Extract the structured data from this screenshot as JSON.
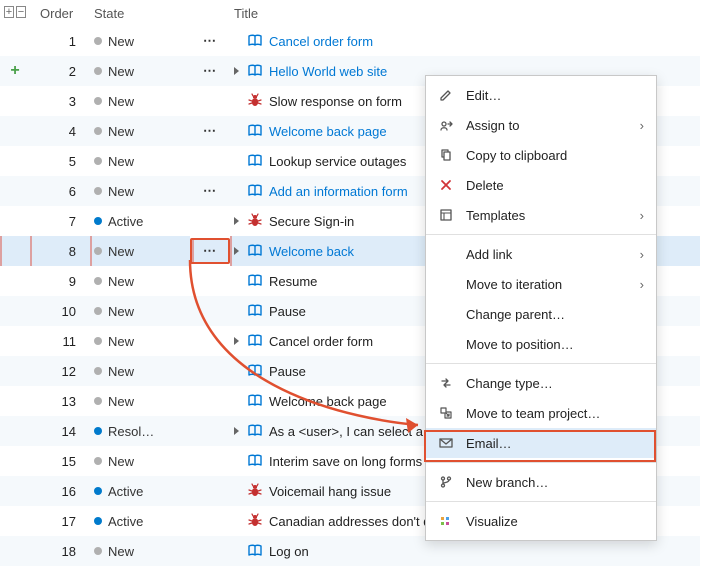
{
  "columns": {
    "order": "Order",
    "state": "State",
    "title": "Title"
  },
  "rows": [
    {
      "order": "1",
      "state": "New",
      "stateColor": "gray",
      "showActions": true,
      "hasChevron": false,
      "iconKind": "book",
      "title": "Cancel order form",
      "link": true,
      "alt": false,
      "gutter": ""
    },
    {
      "order": "2",
      "state": "New",
      "stateColor": "gray",
      "showActions": true,
      "hasChevron": true,
      "iconKind": "book",
      "title": "Hello World web site",
      "link": true,
      "alt": true,
      "gutter": "plus"
    },
    {
      "order": "3",
      "state": "New",
      "stateColor": "gray",
      "showActions": false,
      "hasChevron": false,
      "iconKind": "bug",
      "title": "Slow response on form",
      "link": false,
      "alt": false,
      "gutter": ""
    },
    {
      "order": "4",
      "state": "New",
      "stateColor": "gray",
      "showActions": true,
      "hasChevron": false,
      "iconKind": "book",
      "title": "Welcome back page",
      "link": true,
      "alt": true,
      "gutter": ""
    },
    {
      "order": "5",
      "state": "New",
      "stateColor": "gray",
      "showActions": false,
      "hasChevron": false,
      "iconKind": "book",
      "title": "Lookup service outages",
      "link": false,
      "alt": false,
      "gutter": ""
    },
    {
      "order": "6",
      "state": "New",
      "stateColor": "gray",
      "showActions": true,
      "hasChevron": false,
      "iconKind": "book",
      "title": "Add an information form",
      "link": true,
      "alt": true,
      "gutter": ""
    },
    {
      "order": "7",
      "state": "Active",
      "stateColor": "blue",
      "showActions": false,
      "hasChevron": true,
      "iconKind": "bug",
      "title": "Secure Sign-in",
      "link": false,
      "alt": false,
      "gutter": ""
    },
    {
      "order": "8",
      "state": "New",
      "stateColor": "gray",
      "showActions": true,
      "hasChevron": true,
      "iconKind": "book",
      "title": "Welcome back",
      "link": true,
      "alt": true,
      "gutter": "",
      "selected": true,
      "boxActions": true
    },
    {
      "order": "9",
      "state": "New",
      "stateColor": "gray",
      "showActions": false,
      "hasChevron": false,
      "iconKind": "book",
      "title": "Resume",
      "link": false,
      "alt": false,
      "gutter": ""
    },
    {
      "order": "10",
      "state": "New",
      "stateColor": "gray",
      "showActions": false,
      "hasChevron": false,
      "iconKind": "book",
      "title": "Pause",
      "link": false,
      "alt": true,
      "gutter": ""
    },
    {
      "order": "11",
      "state": "New",
      "stateColor": "gray",
      "showActions": false,
      "hasChevron": true,
      "iconKind": "book",
      "title": "Cancel order form",
      "link": false,
      "alt": false,
      "gutter": ""
    },
    {
      "order": "12",
      "state": "New",
      "stateColor": "gray",
      "showActions": false,
      "hasChevron": false,
      "iconKind": "book",
      "title": "Pause",
      "link": false,
      "alt": true,
      "gutter": ""
    },
    {
      "order": "13",
      "state": "New",
      "stateColor": "gray",
      "showActions": false,
      "hasChevron": false,
      "iconKind": "book",
      "title": "Welcome back page",
      "link": false,
      "alt": false,
      "gutter": ""
    },
    {
      "order": "14",
      "state": "Resol…",
      "stateColor": "blue",
      "showActions": false,
      "hasChevron": true,
      "iconKind": "book",
      "title": "As a <user>, I can select a numbe",
      "link": false,
      "alt": true,
      "gutter": ""
    },
    {
      "order": "15",
      "state": "New",
      "stateColor": "gray",
      "showActions": false,
      "hasChevron": false,
      "iconKind": "book",
      "title": "Interim save on long forms",
      "link": false,
      "alt": false,
      "gutter": ""
    },
    {
      "order": "16",
      "state": "Active",
      "stateColor": "blue",
      "showActions": false,
      "hasChevron": false,
      "iconKind": "bug",
      "title": "Voicemail hang issue",
      "link": false,
      "alt": true,
      "gutter": ""
    },
    {
      "order": "17",
      "state": "Active",
      "stateColor": "blue",
      "showActions": false,
      "hasChevron": false,
      "iconKind": "bug",
      "title": "Canadian addresses don't display",
      "link": false,
      "alt": false,
      "gutter": ""
    },
    {
      "order": "18",
      "state": "New",
      "stateColor": "gray",
      "showActions": false,
      "hasChevron": false,
      "iconKind": "book",
      "title": "Log on",
      "link": false,
      "alt": true,
      "gutter": ""
    }
  ],
  "menu": {
    "groups": [
      [
        {
          "icon": "edit",
          "label": "Edit…",
          "arrow": false
        },
        {
          "icon": "assign",
          "label": "Assign to",
          "arrow": true
        },
        {
          "icon": "copy",
          "label": "Copy to clipboard",
          "arrow": false
        },
        {
          "icon": "delete",
          "label": "Delete",
          "arrow": false
        },
        {
          "icon": "templates",
          "label": "Templates",
          "arrow": true
        }
      ],
      [
        {
          "icon": "",
          "label": "Add link",
          "arrow": true
        },
        {
          "icon": "",
          "label": "Move to iteration",
          "arrow": true
        },
        {
          "icon": "",
          "label": "Change parent…",
          "arrow": false
        },
        {
          "icon": "",
          "label": "Move to position…",
          "arrow": false
        }
      ],
      [
        {
          "icon": "change",
          "label": "Change type…",
          "arrow": false
        },
        {
          "icon": "move",
          "label": "Move to team project…",
          "arrow": false
        },
        {
          "icon": "email",
          "label": "Email…",
          "arrow": false,
          "highlight": true
        }
      ],
      [
        {
          "icon": "branch",
          "label": "New branch…",
          "arrow": false
        }
      ],
      [
        {
          "icon": "visualize",
          "label": "Visualize",
          "arrow": false
        }
      ]
    ]
  }
}
